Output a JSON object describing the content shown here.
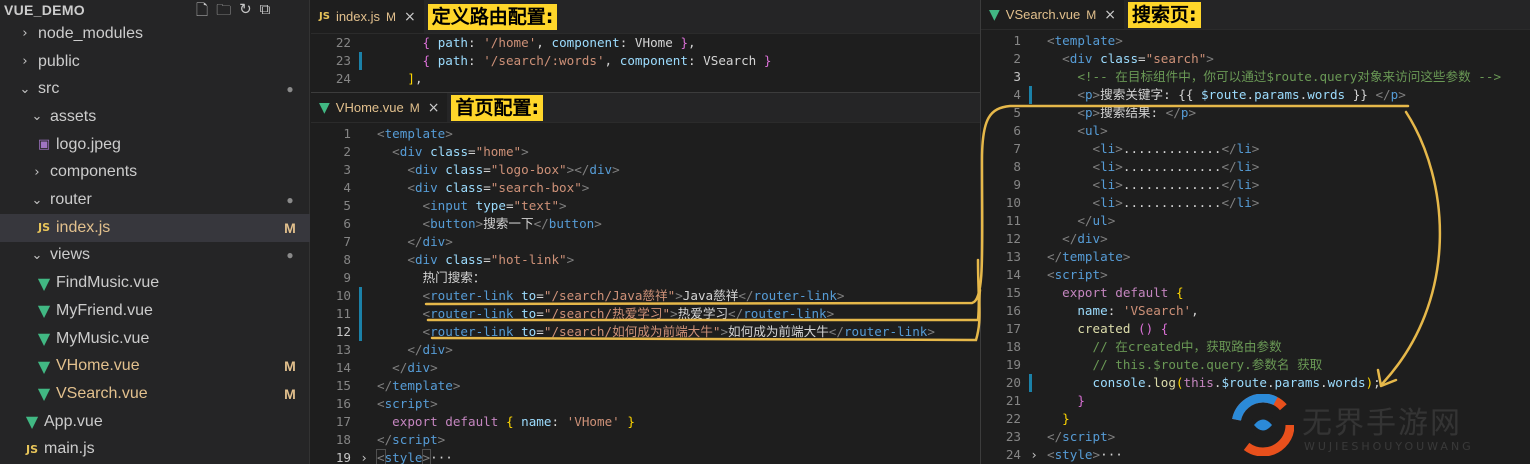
{
  "explorer": {
    "title": "VUE_DEMO",
    "actions": [
      "new-file-icon",
      "new-folder-icon",
      "refresh-icon",
      "collapse-icon"
    ],
    "items": [
      {
        "label": "node_modules",
        "chevron": "›",
        "icon": "",
        "status": ""
      },
      {
        "label": "public",
        "chevron": "›",
        "icon": "",
        "status": ""
      },
      {
        "label": "src",
        "chevron": "⌄",
        "icon": "",
        "status": "●"
      },
      {
        "label": "assets",
        "chevron": "⌄",
        "icon": "",
        "status": ""
      },
      {
        "label": "logo.jpeg",
        "chevron": "",
        "icon": "▣",
        "status": ""
      },
      {
        "label": "components",
        "chevron": "›",
        "icon": "",
        "status": ""
      },
      {
        "label": "router",
        "chevron": "⌄",
        "icon": "",
        "status": "●"
      },
      {
        "label": "index.js",
        "chevron": "",
        "icon": "JS",
        "status": "M"
      },
      {
        "label": "views",
        "chevron": "⌄",
        "icon": "",
        "status": "●"
      },
      {
        "label": "FindMusic.vue",
        "chevron": "",
        "icon": "▼",
        "status": ""
      },
      {
        "label": "MyFriend.vue",
        "chevron": "",
        "icon": "▼",
        "status": ""
      },
      {
        "label": "MyMusic.vue",
        "chevron": "",
        "icon": "▼",
        "status": ""
      },
      {
        "label": "VHome.vue",
        "chevron": "",
        "icon": "▼",
        "status": "M"
      },
      {
        "label": "VSearch.vue",
        "chevron": "",
        "icon": "▼",
        "status": "M"
      },
      {
        "label": "App.vue",
        "chevron": "",
        "icon": "▼",
        "status": ""
      },
      {
        "label": "main.js",
        "chevron": "",
        "icon": "JS",
        "status": ""
      }
    ]
  },
  "router_pane": {
    "tab": {
      "label": "index.js",
      "modified": "M",
      "icon": "JS",
      "close": "×"
    },
    "annotation": "定义路由配置:",
    "line_numbers": [
      "22",
      "23",
      "24"
    ]
  },
  "home_pane": {
    "tab": {
      "label": "VHome.vue",
      "modified": "M",
      "icon": "▼",
      "close": "×"
    },
    "annotation": "首页配置:",
    "line_numbers": [
      "1",
      "2",
      "3",
      "4",
      "5",
      "6",
      "7",
      "8",
      "9",
      "10",
      "11",
      "12",
      "13",
      "14",
      "15",
      "16",
      "17",
      "18",
      "19"
    ]
  },
  "search_pane": {
    "tab": {
      "label": "VSearch.vue",
      "modified": "M",
      "icon": "▼",
      "close": "×"
    },
    "annotation": "搜索页:",
    "line_numbers": [
      "1",
      "2",
      "3",
      "4",
      "5",
      "6",
      "7",
      "8",
      "9",
      "10",
      "11",
      "12",
      "13",
      "14",
      "15",
      "16",
      "17",
      "18",
      "19",
      "20",
      "21",
      "22",
      "23",
      "24"
    ]
  },
  "watermark": {
    "text": "无界手游网",
    "sub": "WUJIESHOUYOUWANG"
  },
  "colors": {
    "annotation_bg": "#ffd62a",
    "arrow": "#e6b84a",
    "editor_bg": "#1e1e1e",
    "sidebar_bg": "#252526"
  }
}
